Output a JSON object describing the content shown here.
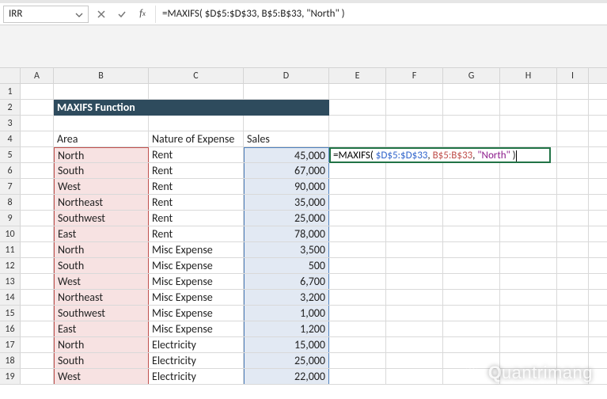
{
  "name_box": {
    "value": "IRR"
  },
  "formula_bar": {
    "text": "=MAXIFS( $D$5:$D$33, B$5:B$33, \"North\" )"
  },
  "columns": [
    "A",
    "B",
    "C",
    "D",
    "E",
    "F",
    "G",
    "H",
    "I"
  ],
  "title": "MAXIFS Function",
  "headers": {
    "area": "Area",
    "nature": "Nature of Expense",
    "sales": "Sales"
  },
  "rows": [
    {
      "n": "1"
    },
    {
      "n": "2"
    },
    {
      "n": "3"
    },
    {
      "n": "4"
    },
    {
      "n": "5",
      "area": "North",
      "nature": "Rent",
      "sales": "45,000"
    },
    {
      "n": "6",
      "area": "South",
      "nature": "Rent",
      "sales": "67,000"
    },
    {
      "n": "7",
      "area": "West",
      "nature": "Rent",
      "sales": "90,000"
    },
    {
      "n": "8",
      "area": "Northeast",
      "nature": "Rent",
      "sales": "35,000"
    },
    {
      "n": "9",
      "area": "Southwest",
      "nature": "Rent",
      "sales": "25,000"
    },
    {
      "n": "10",
      "area": "East",
      "nature": "Rent",
      "sales": "78,000"
    },
    {
      "n": "11",
      "area": "North",
      "nature": "Misc Expense",
      "sales": "3,500"
    },
    {
      "n": "12",
      "area": "South",
      "nature": "Misc Expense",
      "sales": "500"
    },
    {
      "n": "13",
      "area": "West",
      "nature": "Misc Expense",
      "sales": "6,700"
    },
    {
      "n": "14",
      "area": "Northeast",
      "nature": "Misc Expense",
      "sales": "3,200"
    },
    {
      "n": "15",
      "area": "Southwest",
      "nature": "Misc Expense",
      "sales": "1,000"
    },
    {
      "n": "16",
      "area": "East",
      "nature": "Misc Expense",
      "sales": "1,200"
    },
    {
      "n": "17",
      "area": "North",
      "nature": "Electricity",
      "sales": "15,000"
    },
    {
      "n": "18",
      "area": "South",
      "nature": "Electricity",
      "sales": "25,000"
    },
    {
      "n": "19",
      "area": "West",
      "nature": "Electricity",
      "sales": "22,000"
    }
  ],
  "active_cell": {
    "parts": {
      "prefix": "=MAXIFS( ",
      "range1": "$D$5:$D$33",
      "sep1": ", ",
      "range2": "B$5:B$33",
      "sep2": ", ",
      "str": "\"North\"",
      "suffix": " )"
    }
  },
  "watermark": {
    "text": "uantrimang"
  }
}
